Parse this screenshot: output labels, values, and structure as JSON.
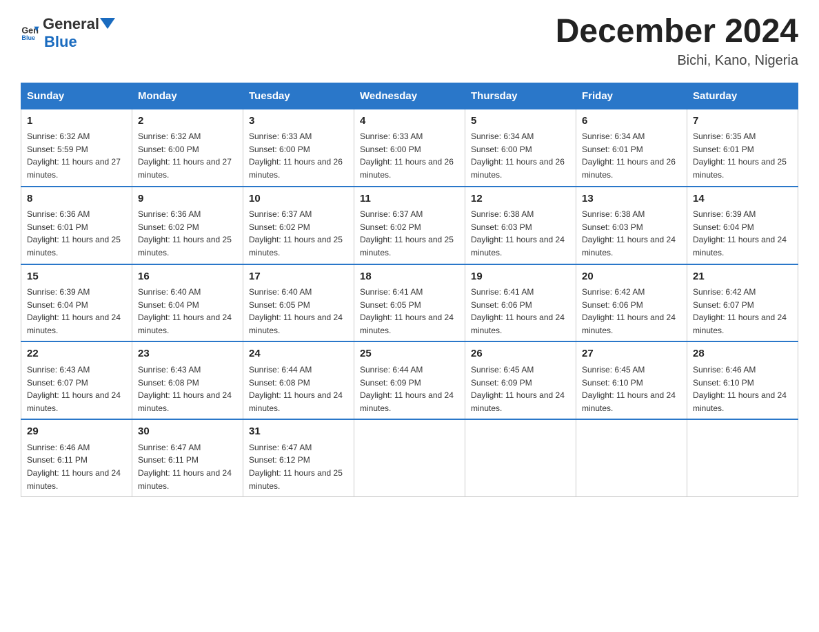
{
  "header": {
    "logo_general": "General",
    "logo_blue": "Blue",
    "month_title": "December 2024",
    "location": "Bichi, Kano, Nigeria"
  },
  "days_of_week": [
    "Sunday",
    "Monday",
    "Tuesday",
    "Wednesday",
    "Thursday",
    "Friday",
    "Saturday"
  ],
  "weeks": [
    [
      {
        "day": "1",
        "sunrise": "6:32 AM",
        "sunset": "5:59 PM",
        "daylight": "11 hours and 27 minutes."
      },
      {
        "day": "2",
        "sunrise": "6:32 AM",
        "sunset": "6:00 PM",
        "daylight": "11 hours and 27 minutes."
      },
      {
        "day": "3",
        "sunrise": "6:33 AM",
        "sunset": "6:00 PM",
        "daylight": "11 hours and 26 minutes."
      },
      {
        "day": "4",
        "sunrise": "6:33 AM",
        "sunset": "6:00 PM",
        "daylight": "11 hours and 26 minutes."
      },
      {
        "day": "5",
        "sunrise": "6:34 AM",
        "sunset": "6:00 PM",
        "daylight": "11 hours and 26 minutes."
      },
      {
        "day": "6",
        "sunrise": "6:34 AM",
        "sunset": "6:01 PM",
        "daylight": "11 hours and 26 minutes."
      },
      {
        "day": "7",
        "sunrise": "6:35 AM",
        "sunset": "6:01 PM",
        "daylight": "11 hours and 25 minutes."
      }
    ],
    [
      {
        "day": "8",
        "sunrise": "6:36 AM",
        "sunset": "6:01 PM",
        "daylight": "11 hours and 25 minutes."
      },
      {
        "day": "9",
        "sunrise": "6:36 AM",
        "sunset": "6:02 PM",
        "daylight": "11 hours and 25 minutes."
      },
      {
        "day": "10",
        "sunrise": "6:37 AM",
        "sunset": "6:02 PM",
        "daylight": "11 hours and 25 minutes."
      },
      {
        "day": "11",
        "sunrise": "6:37 AM",
        "sunset": "6:02 PM",
        "daylight": "11 hours and 25 minutes."
      },
      {
        "day": "12",
        "sunrise": "6:38 AM",
        "sunset": "6:03 PM",
        "daylight": "11 hours and 24 minutes."
      },
      {
        "day": "13",
        "sunrise": "6:38 AM",
        "sunset": "6:03 PM",
        "daylight": "11 hours and 24 minutes."
      },
      {
        "day": "14",
        "sunrise": "6:39 AM",
        "sunset": "6:04 PM",
        "daylight": "11 hours and 24 minutes."
      }
    ],
    [
      {
        "day": "15",
        "sunrise": "6:39 AM",
        "sunset": "6:04 PM",
        "daylight": "11 hours and 24 minutes."
      },
      {
        "day": "16",
        "sunrise": "6:40 AM",
        "sunset": "6:04 PM",
        "daylight": "11 hours and 24 minutes."
      },
      {
        "day": "17",
        "sunrise": "6:40 AM",
        "sunset": "6:05 PM",
        "daylight": "11 hours and 24 minutes."
      },
      {
        "day": "18",
        "sunrise": "6:41 AM",
        "sunset": "6:05 PM",
        "daylight": "11 hours and 24 minutes."
      },
      {
        "day": "19",
        "sunrise": "6:41 AM",
        "sunset": "6:06 PM",
        "daylight": "11 hours and 24 minutes."
      },
      {
        "day": "20",
        "sunrise": "6:42 AM",
        "sunset": "6:06 PM",
        "daylight": "11 hours and 24 minutes."
      },
      {
        "day": "21",
        "sunrise": "6:42 AM",
        "sunset": "6:07 PM",
        "daylight": "11 hours and 24 minutes."
      }
    ],
    [
      {
        "day": "22",
        "sunrise": "6:43 AM",
        "sunset": "6:07 PM",
        "daylight": "11 hours and 24 minutes."
      },
      {
        "day": "23",
        "sunrise": "6:43 AM",
        "sunset": "6:08 PM",
        "daylight": "11 hours and 24 minutes."
      },
      {
        "day": "24",
        "sunrise": "6:44 AM",
        "sunset": "6:08 PM",
        "daylight": "11 hours and 24 minutes."
      },
      {
        "day": "25",
        "sunrise": "6:44 AM",
        "sunset": "6:09 PM",
        "daylight": "11 hours and 24 minutes."
      },
      {
        "day": "26",
        "sunrise": "6:45 AM",
        "sunset": "6:09 PM",
        "daylight": "11 hours and 24 minutes."
      },
      {
        "day": "27",
        "sunrise": "6:45 AM",
        "sunset": "6:10 PM",
        "daylight": "11 hours and 24 minutes."
      },
      {
        "day": "28",
        "sunrise": "6:46 AM",
        "sunset": "6:10 PM",
        "daylight": "11 hours and 24 minutes."
      }
    ],
    [
      {
        "day": "29",
        "sunrise": "6:46 AM",
        "sunset": "6:11 PM",
        "daylight": "11 hours and 24 minutes."
      },
      {
        "day": "30",
        "sunrise": "6:47 AM",
        "sunset": "6:11 PM",
        "daylight": "11 hours and 24 minutes."
      },
      {
        "day": "31",
        "sunrise": "6:47 AM",
        "sunset": "6:12 PM",
        "daylight": "11 hours and 25 minutes."
      },
      null,
      null,
      null,
      null
    ]
  ]
}
